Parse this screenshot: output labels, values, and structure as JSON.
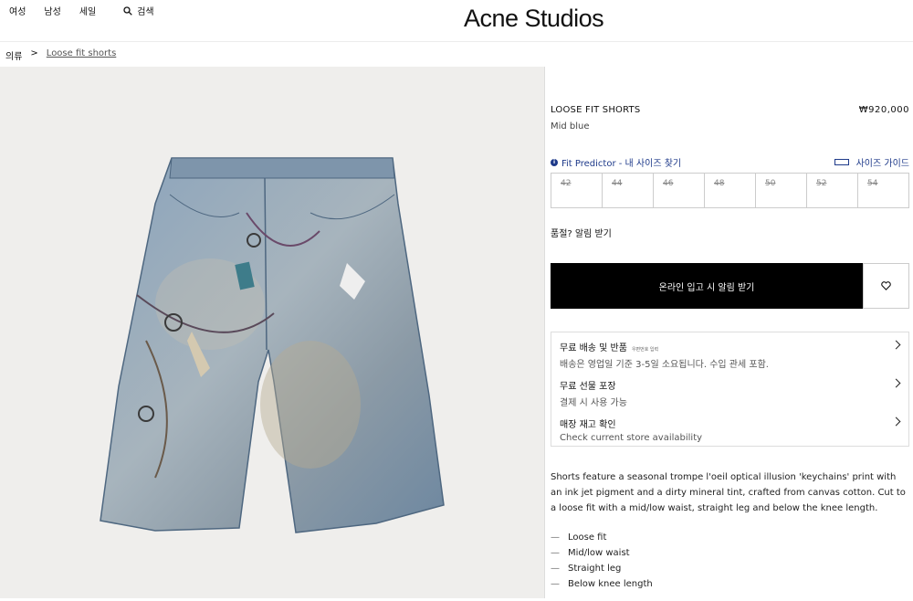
{
  "header": {
    "nav": [
      "여성",
      "남성",
      "세일"
    ],
    "search_label": "검색",
    "logo": "Acne Studios"
  },
  "breadcrumb": {
    "root": "의류",
    "separator": ">",
    "current": "Loose fit shorts"
  },
  "product": {
    "name": "LOOSE FIT SHORTS",
    "price": "₩920,000",
    "color": "Mid blue",
    "fit_predictor": "Fit Predictor - 내 사이즈 찾기",
    "size_guide": "사이즈 가이드",
    "sizes": [
      "42",
      "44",
      "46",
      "48",
      "50",
      "52",
      "54"
    ],
    "sold_out_notice": "품절? 알림 받기",
    "cta_label": "온라인 입고 시 알림 받기",
    "wishlist_icon": "heart-icon"
  },
  "services": [
    {
      "title": "무료 배송 및 반품",
      "note": "우편번호 입력",
      "subtitle": "배송은 영업일 기준 3-5일 소요됩니다. 수입 관세 포함."
    },
    {
      "title": "무료 선물 포장",
      "note": "",
      "subtitle": "결제 시 사용 가능"
    },
    {
      "title": "매장 재고 확인",
      "note": "",
      "subtitle": "Check current store availability"
    }
  ],
  "description": "Shorts feature a seasonal trompe l'oeil optical illusion 'keychains' print with an ink jet pigment and a dirty mineral tint, crafted from canvas cotton. Cut to a loose fit with a mid/low waist, straight leg and below the knee length.",
  "features": [
    "Loose fit",
    "Mid/low waist",
    "Straight leg",
    "Below knee length"
  ],
  "colors": {
    "accent": "#1e3a8a",
    "cta_bg": "#000000",
    "denim": "#7f9ab3"
  }
}
